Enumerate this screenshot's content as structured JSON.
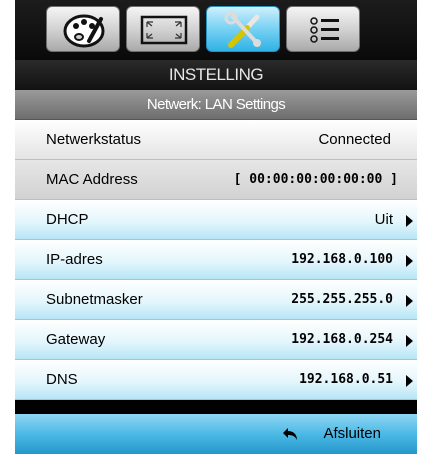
{
  "tabs": [
    {
      "icon": "palette-icon",
      "active": false
    },
    {
      "icon": "screen-resize-icon",
      "active": false
    },
    {
      "icon": "tools-icon",
      "active": true
    },
    {
      "icon": "options-list-icon",
      "active": false
    }
  ],
  "title": "INSTELLING",
  "subtitle": "Netwerk: LAN Settings",
  "rows": [
    {
      "label": "Netwerkstatus",
      "value": "Connected"
    },
    {
      "label": "MAC Address",
      "value": "[ 00:00:00:00:00:00 ]"
    },
    {
      "label": "DHCP",
      "value": "Uit"
    },
    {
      "label": "IP-adres",
      "value": "192.168.0.100"
    },
    {
      "label": "Subnetmasker",
      "value": "255.255.255.0"
    },
    {
      "label": "Gateway",
      "value": "192.168.0.254"
    },
    {
      "label": "DNS",
      "value": "192.168.0.51"
    }
  ],
  "footer": {
    "exit_label": "Afsluiten",
    "exit_icon": "return-arrow-icon"
  },
  "colors": {
    "accent": "#2fb3e6",
    "selected_row": "#b7e6f6"
  }
}
